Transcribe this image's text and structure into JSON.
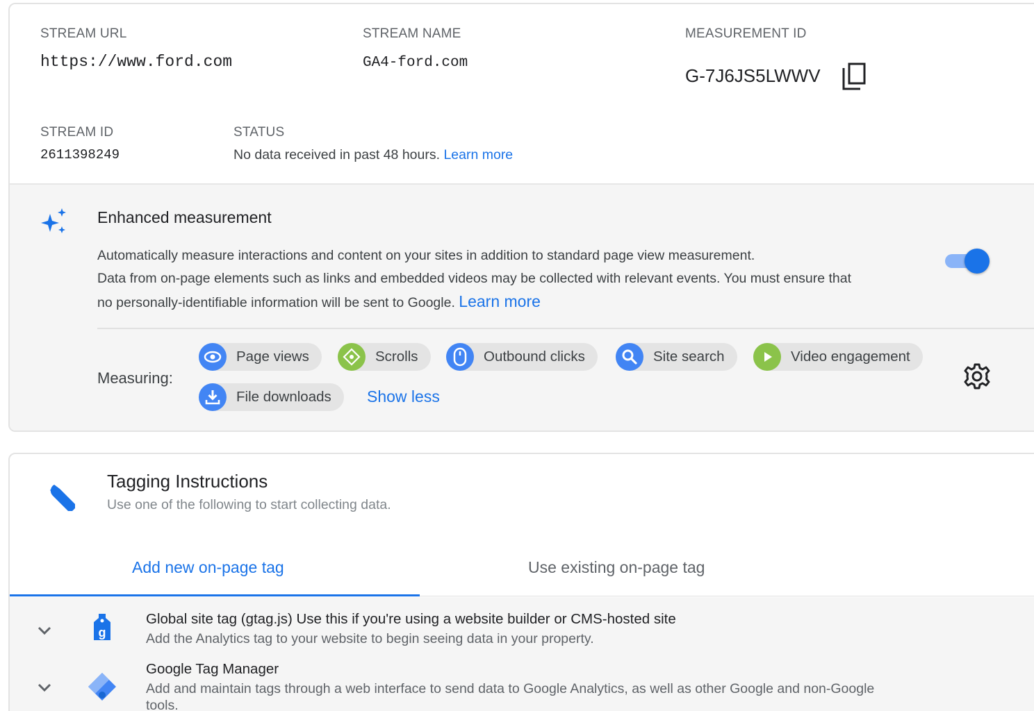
{
  "stream": {
    "url_label": "STREAM URL",
    "url_value": "https://www.ford.com",
    "name_label": "STREAM NAME",
    "name_value": "GA4-ford.com",
    "measurement_label": "MEASUREMENT ID",
    "measurement_value": "G-7J6JS5LWWV",
    "id_label": "STREAM ID",
    "id_value": "2611398249",
    "status_label": "STATUS",
    "status_text": "No data received in past 48 hours.",
    "status_link": "Learn more"
  },
  "enhanced": {
    "title": "Enhanced measurement",
    "line1": "Automatically measure interactions and content on your sites in addition to standard page view measurement.",
    "line2": "Data from on-page elements such as links and embedded videos may be collected with relevant events. You must ensure that",
    "line3": "no personally-identifiable information will be sent to Google.",
    "learn_more": "Learn more",
    "toggle_on": true,
    "measuring_label": "Measuring:",
    "chips": [
      {
        "label": "Page views",
        "icon": "eye-icon"
      },
      {
        "label": "Scrolls",
        "icon": "scroll-arrows-icon"
      },
      {
        "label": "Outbound clicks",
        "icon": "mouse-icon"
      },
      {
        "label": "Site search",
        "icon": "search-icon"
      },
      {
        "label": "Video engagement",
        "icon": "play-icon"
      },
      {
        "label": "File downloads",
        "icon": "download-icon"
      }
    ],
    "show_less": "Show less"
  },
  "tagging": {
    "title": "Tagging Instructions",
    "subtitle": "Use one of the following to start collecting data.",
    "tabs": [
      {
        "label": "Add new on-page tag",
        "active": true
      },
      {
        "label": "Use existing on-page tag",
        "active": false
      }
    ],
    "items": [
      {
        "title": "Global site tag (gtag.js) Use this if you're using a website builder or CMS-hosted site",
        "subtitle": "Add the Analytics tag to your website to begin seeing data in your property."
      },
      {
        "title": "Google Tag Manager",
        "subtitle": "Add and maintain tags through a web interface to send data to Google Analytics, as well as other Google and non-Google",
        "subtitle2": "tools."
      }
    ]
  },
  "colors": {
    "accent": "#1a73e8",
    "chip_blue": "#4285f4",
    "chip_green": "#8bc34a",
    "panel_bg": "#f5f5f5"
  }
}
